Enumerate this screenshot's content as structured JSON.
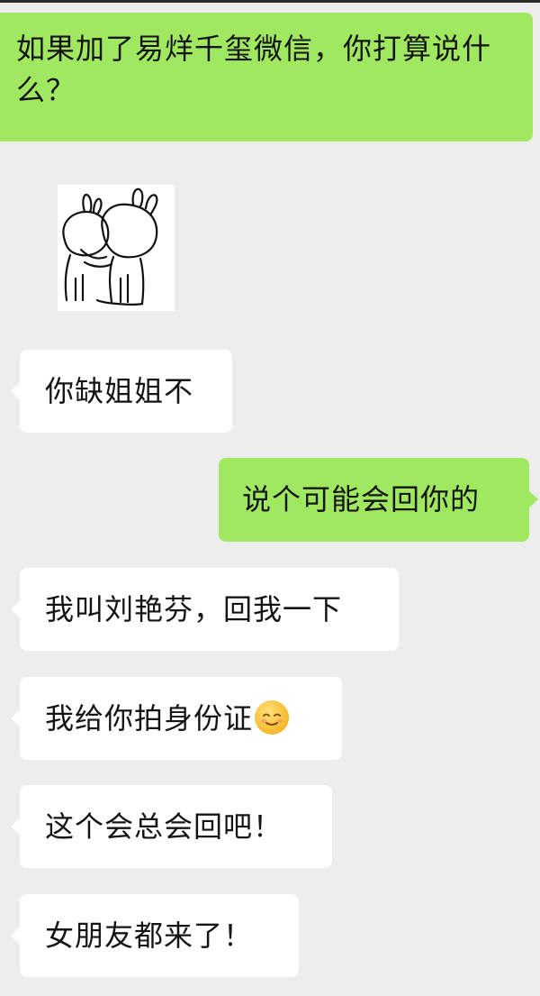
{
  "messages": [
    {
      "id": "b1",
      "side": "right",
      "text": "如果加了易烊千玺微信，你打算说什么？"
    },
    {
      "id": "sticker",
      "side": "left",
      "type": "sticker",
      "icon": "hugging-rabbit-sticker"
    },
    {
      "id": "b2",
      "side": "left",
      "text": "你缺姐姐不"
    },
    {
      "id": "b3",
      "side": "right",
      "text": "说个可能会回你的"
    },
    {
      "id": "b4",
      "side": "left",
      "text": "我叫刘艳芬，回我一下"
    },
    {
      "id": "b5",
      "side": "left",
      "text": "我给你拍身份证",
      "emoji": "smiling-face-emoji"
    },
    {
      "id": "b6",
      "side": "left",
      "text": "这个会总会回吧！"
    },
    {
      "id": "b7",
      "side": "left",
      "text": "女朋友都来了！"
    }
  ],
  "colors": {
    "background": "#ededed",
    "sent_bubble": "#9fe85f",
    "received_bubble": "#ffffff",
    "text": "#141414"
  }
}
